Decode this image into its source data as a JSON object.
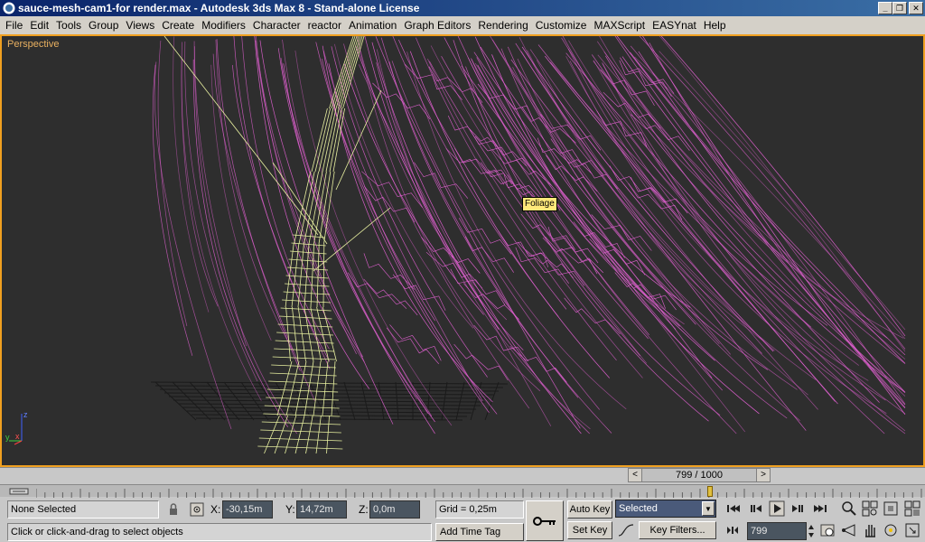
{
  "window": {
    "title": "sauce-mesh-cam1-for render.max  - Autodesk 3ds Max 8  - Stand-alone License",
    "controls": {
      "minimize": "_",
      "restore": "❐",
      "close": "✕"
    }
  },
  "menu": [
    "File",
    "Edit",
    "Tools",
    "Group",
    "Views",
    "Create",
    "Modifiers",
    "Character",
    "reactor",
    "Animation",
    "Graph Editors",
    "Rendering",
    "Customize",
    "MAXScript",
    "EASYnat",
    "Help"
  ],
  "viewport": {
    "label": "Perspective",
    "tooltip": "Foliage",
    "axes": {
      "z": "z",
      "y": "y",
      "x": "x"
    },
    "colors": {
      "foliage": "#e060d0",
      "trunk": "#e8f0a0",
      "border": "#f0a020",
      "background": "#2e2e2e",
      "grid": "#1a1a1a"
    }
  },
  "timeline": {
    "frame_display": "799 / 1000",
    "prev": "<",
    "next": ">",
    "current_frame": 799,
    "total_frames": 1000
  },
  "status": {
    "selection": "None Selected",
    "prompt": "Click or click-and-drag to select objects",
    "x_label": "X:",
    "x_value": "-30,15m",
    "y_label": "Y:",
    "y_value": "14,72m",
    "z_label": "Z:",
    "z_value": "0,0m",
    "grid": "Grid = 0,25m",
    "add_time_tag": "Add Time Tag",
    "auto_key": "Auto Key",
    "set_key": "Set Key",
    "key_mode": "Selected",
    "key_filters": "Key Filters...",
    "frame_input": "799"
  }
}
